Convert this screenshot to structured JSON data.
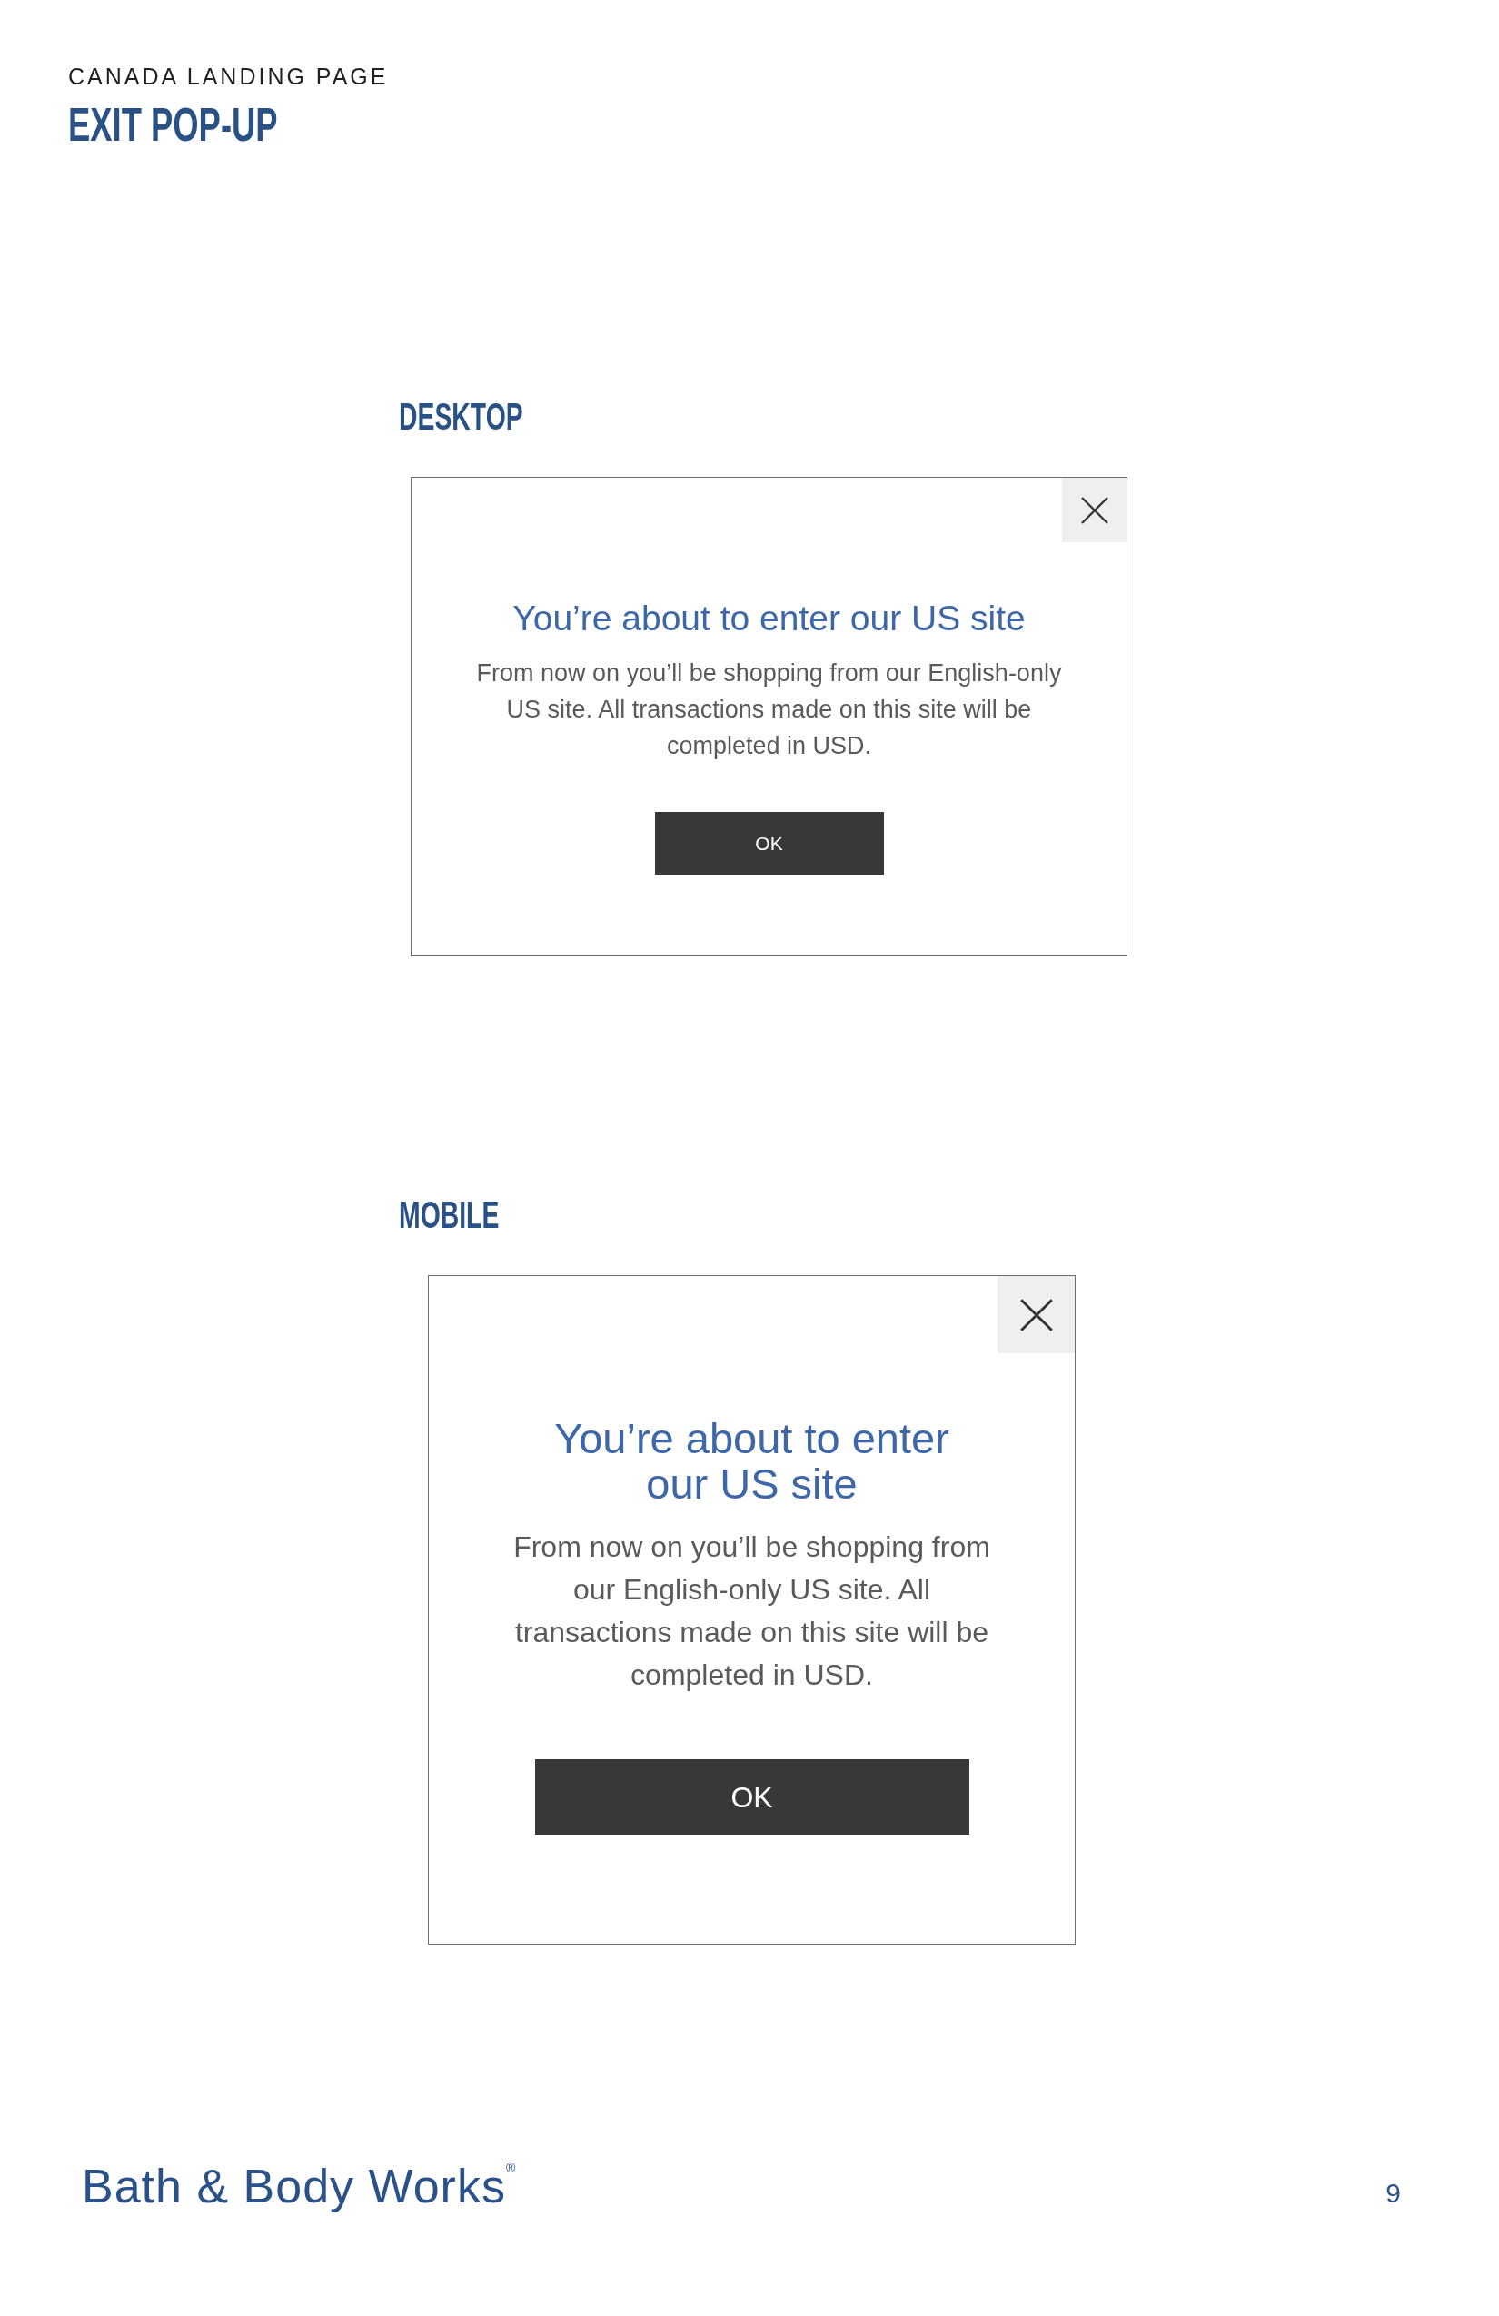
{
  "header": {
    "eyebrow": "CANADA LANDING PAGE",
    "title": "EXIT POP-UP"
  },
  "sections": [
    {
      "kind": "desktop",
      "label": "DESKTOP",
      "popup": {
        "title": "You’re about to enter our US site",
        "message": "From now on you’ll be shopping from our English-only US site. All transactions made on this site will be completed in USD.",
        "button": "OK"
      }
    },
    {
      "kind": "mobile",
      "label": "MOBILE",
      "popup": {
        "title": "You’re about to enter our US site",
        "message": "From now on you’ll be shopping from our English-only US site. All transactions made on this site will be completed in USD.",
        "button": "OK"
      }
    }
  ],
  "footer": {
    "logo": "Bath & Body Works$^{®}$",
    "page_number": "9"
  }
}
